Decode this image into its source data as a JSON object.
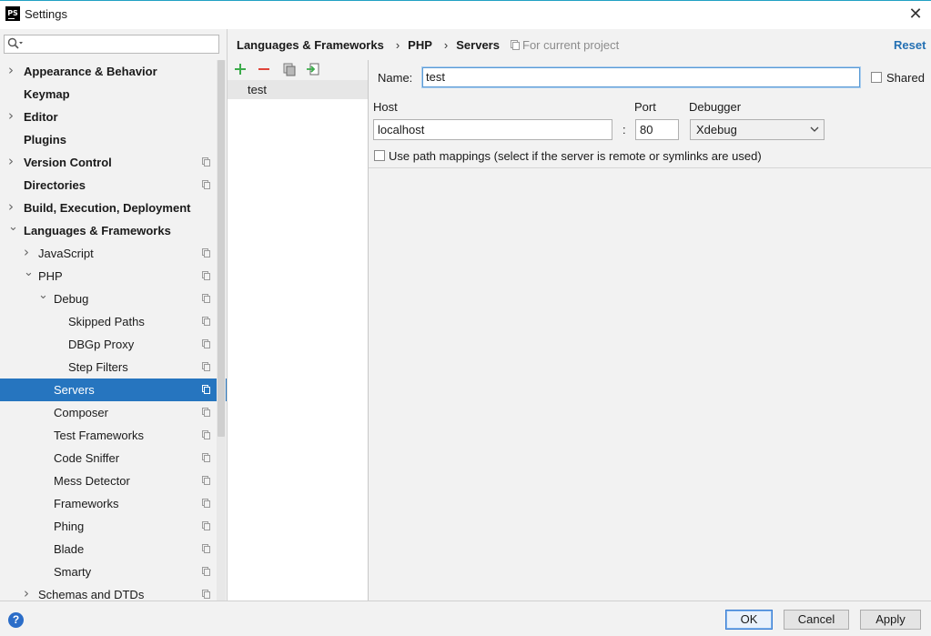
{
  "window": {
    "title": "Settings",
    "logo_text": "PS"
  },
  "search": {
    "placeholder": ""
  },
  "sidebar": {
    "items": [
      {
        "label": "Appearance & Behavior",
        "bold": true,
        "arrow": "right",
        "indent": 0,
        "project_icon": false
      },
      {
        "label": "Keymap",
        "bold": true,
        "arrow": "",
        "indent": 0,
        "project_icon": false
      },
      {
        "label": "Editor",
        "bold": true,
        "arrow": "right",
        "indent": 0,
        "project_icon": false
      },
      {
        "label": "Plugins",
        "bold": true,
        "arrow": "",
        "indent": 0,
        "project_icon": false
      },
      {
        "label": "Version Control",
        "bold": true,
        "arrow": "right",
        "indent": 0,
        "project_icon": true
      },
      {
        "label": "Directories",
        "bold": true,
        "arrow": "",
        "indent": 0,
        "project_icon": true
      },
      {
        "label": "Build, Execution, Deployment",
        "bold": true,
        "arrow": "right",
        "indent": 0,
        "project_icon": false
      },
      {
        "label": "Languages & Frameworks",
        "bold": true,
        "arrow": "down",
        "indent": 0,
        "project_icon": false
      },
      {
        "label": "JavaScript",
        "bold": false,
        "arrow": "right",
        "indent": 1,
        "project_icon": true
      },
      {
        "label": "PHP",
        "bold": false,
        "arrow": "down",
        "indent": 1,
        "project_icon": true
      },
      {
        "label": "Debug",
        "bold": false,
        "arrow": "down",
        "indent": 2,
        "project_icon": true
      },
      {
        "label": "Skipped Paths",
        "bold": false,
        "arrow": "",
        "indent": 3,
        "project_icon": true
      },
      {
        "label": "DBGp Proxy",
        "bold": false,
        "arrow": "",
        "indent": 3,
        "project_icon": true
      },
      {
        "label": "Step Filters",
        "bold": false,
        "arrow": "",
        "indent": 3,
        "project_icon": true
      },
      {
        "label": "Servers",
        "bold": false,
        "arrow": "",
        "indent": 2,
        "project_icon": true,
        "selected": true
      },
      {
        "label": "Composer",
        "bold": false,
        "arrow": "",
        "indent": 2,
        "project_icon": true
      },
      {
        "label": "Test Frameworks",
        "bold": false,
        "arrow": "",
        "indent": 2,
        "project_icon": true
      },
      {
        "label": "Code Sniffer",
        "bold": false,
        "arrow": "",
        "indent": 2,
        "project_icon": true
      },
      {
        "label": "Mess Detector",
        "bold": false,
        "arrow": "",
        "indent": 2,
        "project_icon": true
      },
      {
        "label": "Frameworks",
        "bold": false,
        "arrow": "",
        "indent": 2,
        "project_icon": true
      },
      {
        "label": "Phing",
        "bold": false,
        "arrow": "",
        "indent": 2,
        "project_icon": true
      },
      {
        "label": "Blade",
        "bold": false,
        "arrow": "",
        "indent": 2,
        "project_icon": true
      },
      {
        "label": "Smarty",
        "bold": false,
        "arrow": "",
        "indent": 2,
        "project_icon": true
      },
      {
        "label": "Schemas and DTDs",
        "bold": false,
        "arrow": "right",
        "indent": 1,
        "project_icon": true
      }
    ]
  },
  "header": {
    "breadcrumb": [
      "Languages & Frameworks",
      "PHP",
      "Servers"
    ],
    "separator": "›",
    "for_current_project": "For current project",
    "reset_label": "Reset"
  },
  "servers": {
    "items": [
      "test"
    ]
  },
  "form": {
    "name_label": "Name:",
    "name_value": "test",
    "shared_label": "Shared",
    "host_label": "Host",
    "host_value": "localhost",
    "colon": ":",
    "port_label": "Port",
    "port_value": "80",
    "debugger_label": "Debugger",
    "debugger_value": "Xdebug",
    "path_mappings_label": "Use path mappings (select if the server is remote or symlinks are used)"
  },
  "buttons": {
    "ok": "OK",
    "cancel": "Cancel",
    "apply": "Apply",
    "help": "?"
  },
  "colors": {
    "accent": "#2675bf",
    "add": "#3cab4b",
    "remove": "#e0443a",
    "link": "#2470b3"
  }
}
